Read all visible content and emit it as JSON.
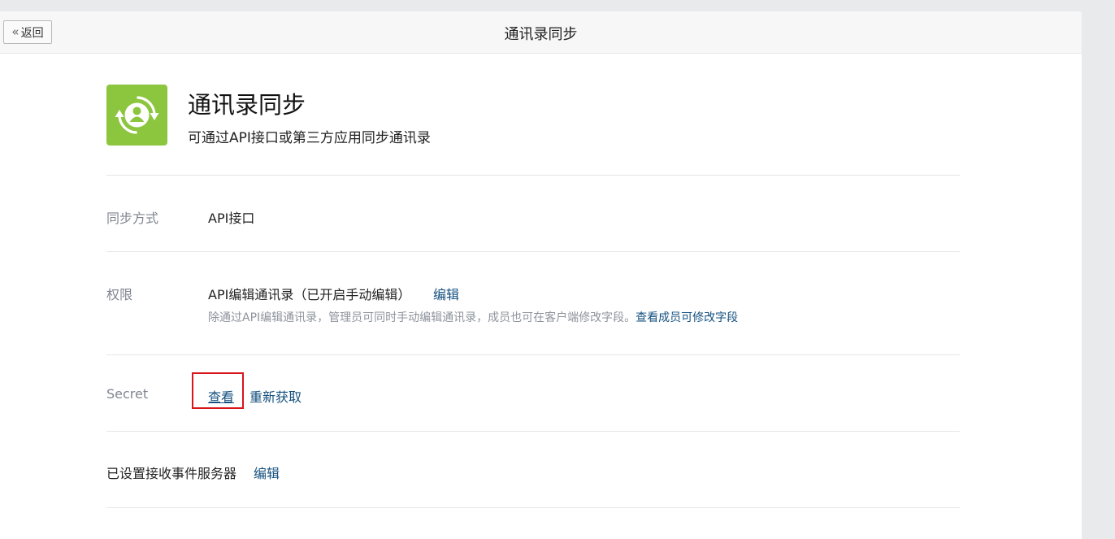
{
  "header": {
    "back_label": "返回",
    "title": "通讯录同步"
  },
  "app": {
    "icon": "contacts-sync-icon",
    "accent_color": "#8cc63f",
    "name": "通讯录同步",
    "description": "可通过API接口或第三方应用同步通讯录"
  },
  "sync_method": {
    "label": "同步方式",
    "value": "API接口"
  },
  "permission": {
    "label": "权限",
    "value": "API编辑通讯录（已开启手动编辑）",
    "edit_label": "编辑",
    "hint": "除通过API编辑通讯录，管理员可同时手动编辑通讯录，成员也可在客户端修改字段。",
    "hint_link": "查看成员可修改字段"
  },
  "secret": {
    "label": "Secret",
    "view_label": "查看",
    "refresh_label": "重新获取"
  },
  "event_server": {
    "label": "已设置接收事件服务器",
    "edit_label": "编辑"
  },
  "colors": {
    "link": "#15507f",
    "highlight": "#d7151b"
  }
}
